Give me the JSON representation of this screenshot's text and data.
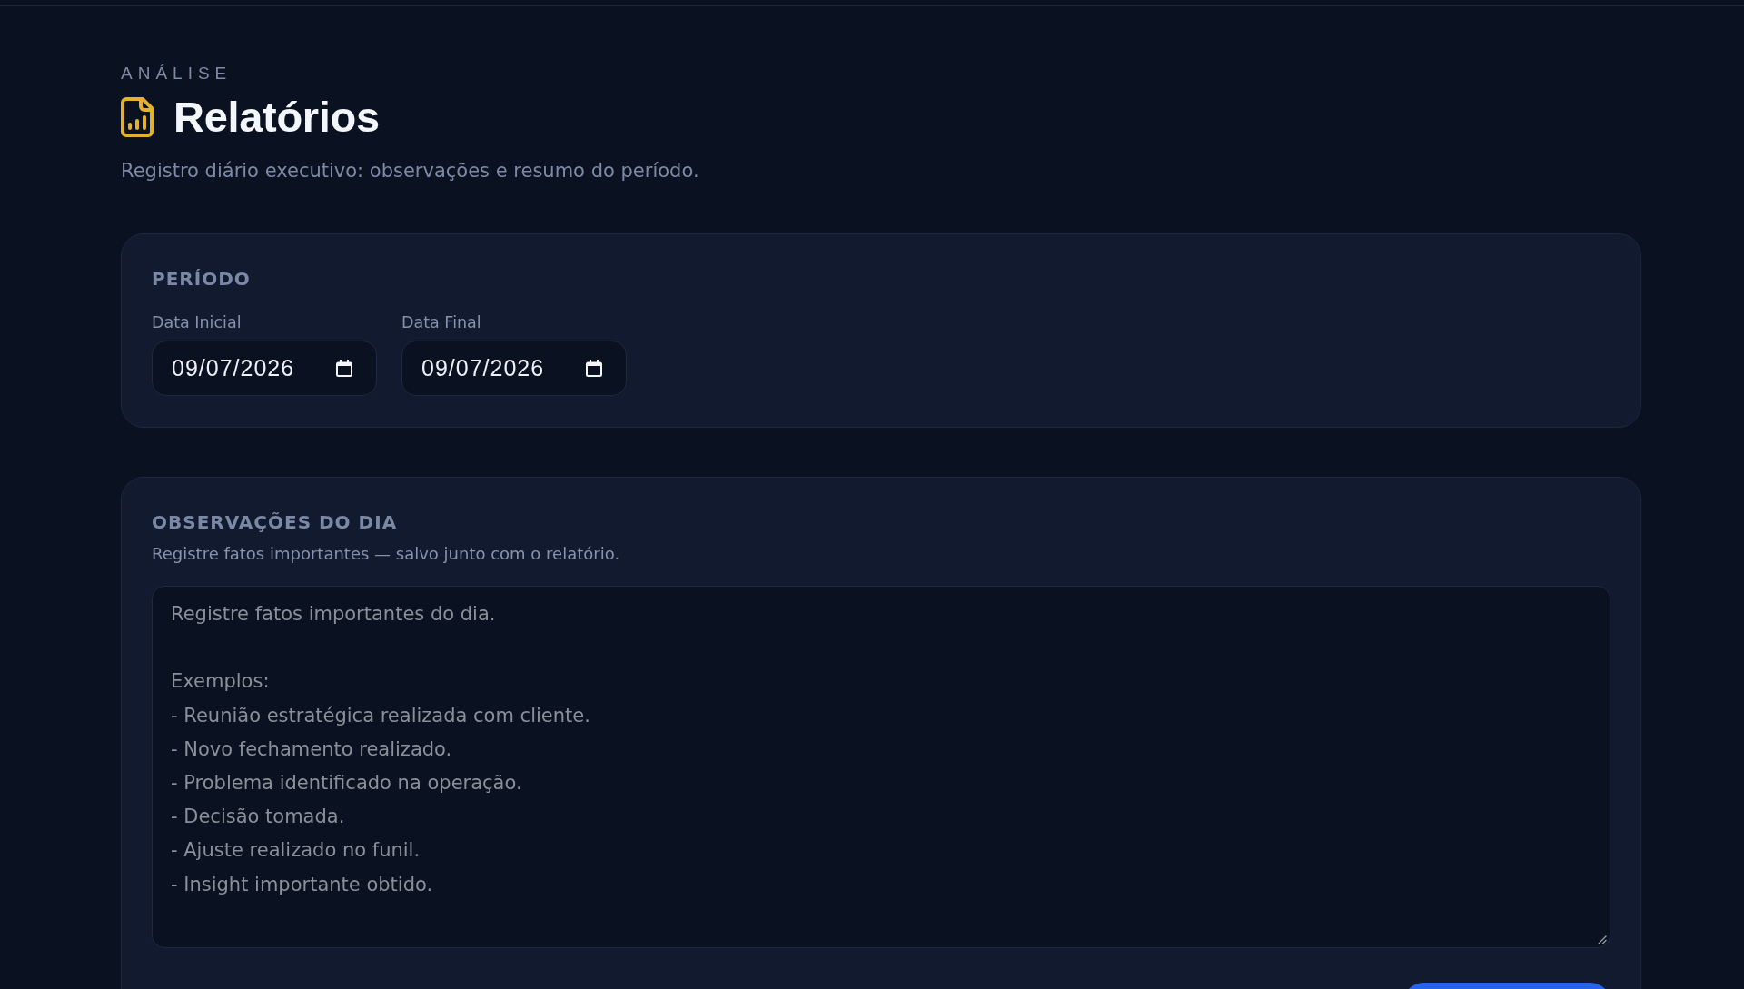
{
  "header": {
    "eyebrow": "ANÁLISE",
    "title": "Relatórios",
    "subtitle": "Registro diário executivo: observações e resumo do período."
  },
  "period": {
    "title": "PERÍODO",
    "fields": [
      {
        "label": "Data Inicial",
        "value": "09/07/2026"
      },
      {
        "label": "Data Final",
        "value": "09/07/2026"
      }
    ]
  },
  "observations": {
    "title": "OBSERVAÇÕES DO DIA",
    "description": "Registre fatos importantes — salvo junto com o relatório.",
    "placeholder": "Registre fatos importantes do dia.\n\nExemplos:\n- Reunião estratégica realizada com cliente.\n- Novo fechamento realizado.\n- Problema identificado na operação.\n- Decisão tomada.\n- Ajuste realizado no funil.\n- Insight importante obtido."
  },
  "actions": [
    {
      "kind": "primary"
    }
  ]
}
